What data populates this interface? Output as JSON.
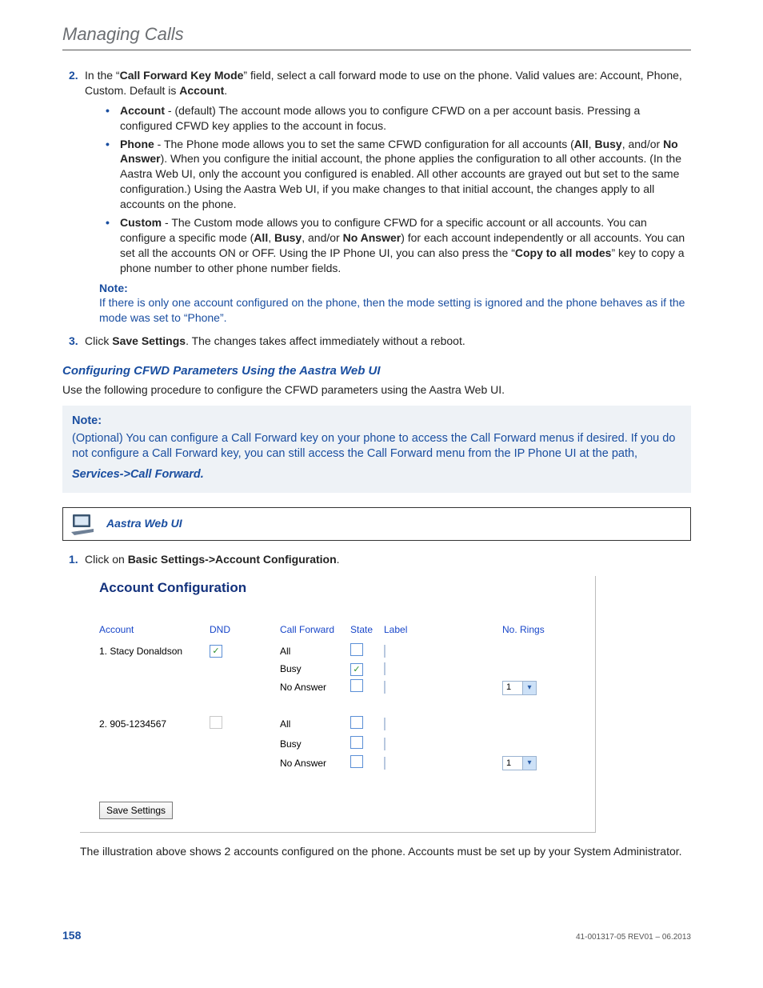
{
  "header": {
    "title": "Managing Calls"
  },
  "step2": {
    "num": "2.",
    "pre": "In the “",
    "field": "Call Forward Key Mode",
    "post": "” field, select a call forward mode to use on the phone. Valid values are: Account, Phone, Custom. Default is ",
    "def": "Account",
    "dot": "."
  },
  "bullets": {
    "account": {
      "name": "Account",
      "text": " - (default) The account mode allows you to configure CFWD on a per account basis. Pressing a configured CFWD key applies to the account in focus."
    },
    "phone": {
      "name": "Phone",
      "p1": " - The Phone mode allows you to set the same CFWD configuration for all accounts (",
      "all": "All",
      "c1": ", ",
      "busy": "Busy",
      "c2": ", and/or ",
      "noans": "No Answer",
      "p2": "). When you configure the initial account, the phone applies the configuration to all other accounts. (In the Aastra Web UI, only the account you configured is enabled. All other accounts are grayed out but set to the same configuration.) Using the Aastra Web UI, if you make changes to that initial account, the changes apply to all accounts on the phone."
    },
    "custom": {
      "name": "Custom",
      "p1": " - The Custom mode allows you to configure CFWD for a specific account or all accounts. You can configure a specific mode (",
      "all": "All",
      "c1": ", ",
      "busy": "Busy",
      "c2": ", and/or ",
      "noans": "No Answer",
      "p2": ") for each account independently or all accounts. You can set all the accounts ON or OFF. Using the IP Phone UI, you can also press the “",
      "copy": "Copy to all modes",
      "p3": "” key to copy a phone number to other phone number fields."
    }
  },
  "note1": {
    "label": "Note:",
    "text": "If there is only one account configured on the phone, then the mode setting is ignored and the phone behaves as if the mode was set to “Phone”."
  },
  "step3": {
    "num": "3.",
    "pre": "Click ",
    "btn": "Save Settings",
    "post": ". The changes takes affect immediately without a reboot."
  },
  "subhead": "Configuring CFWD Parameters Using the Aastra Web UI",
  "intro": "Use the following procedure to configure the CFWD parameters using the Aastra Web UI.",
  "notebox": {
    "label": "Note:",
    "text": "(Optional) You can configure a Call Forward key on your phone to access the Call Forward menus if desired. If you do not configure a Call Forward key, you can still access the Call Forward menu from the IP Phone UI at the path,"
  },
  "pathline": "Services->Call Forward",
  "webui": {
    "label": "Aastra Web UI"
  },
  "step1b": {
    "num": "1.",
    "pre": "Click on ",
    "bold": "Basic Settings->Account Configuration",
    "post": "."
  },
  "figure": {
    "title": "Account Configuration",
    "headers": {
      "account": "Account",
      "dnd": "DND",
      "cfwd": "Call Forward",
      "state": "State",
      "label": "Label",
      "rings": "No. Rings"
    },
    "rows": [
      {
        "account": "1. Stacy Donaldson",
        "dnd": true,
        "lines": [
          {
            "cfwd": "All",
            "state": false,
            "label": "",
            "rings": null
          },
          {
            "cfwd": "Busy",
            "state": true,
            "label": "",
            "rings": null
          },
          {
            "cfwd": "No Answer",
            "state": false,
            "label": "",
            "rings": "1"
          }
        ]
      },
      {
        "account": "2. 905-1234567",
        "dnd": false,
        "lines": [
          {
            "cfwd": "All",
            "state": false,
            "label": "",
            "rings": null
          },
          {
            "cfwd": "Busy",
            "state": false,
            "label": "",
            "rings": null
          },
          {
            "cfwd": "No Answer",
            "state": false,
            "label": "",
            "rings": "1"
          }
        ]
      }
    ],
    "save": "Save Settings"
  },
  "caption": "The illustration above shows 2 accounts configured on the phone. Accounts must be set up by your System Administrator.",
  "footer": {
    "page": "158",
    "docid": "41-001317-05 REV01 – 06.2013"
  }
}
